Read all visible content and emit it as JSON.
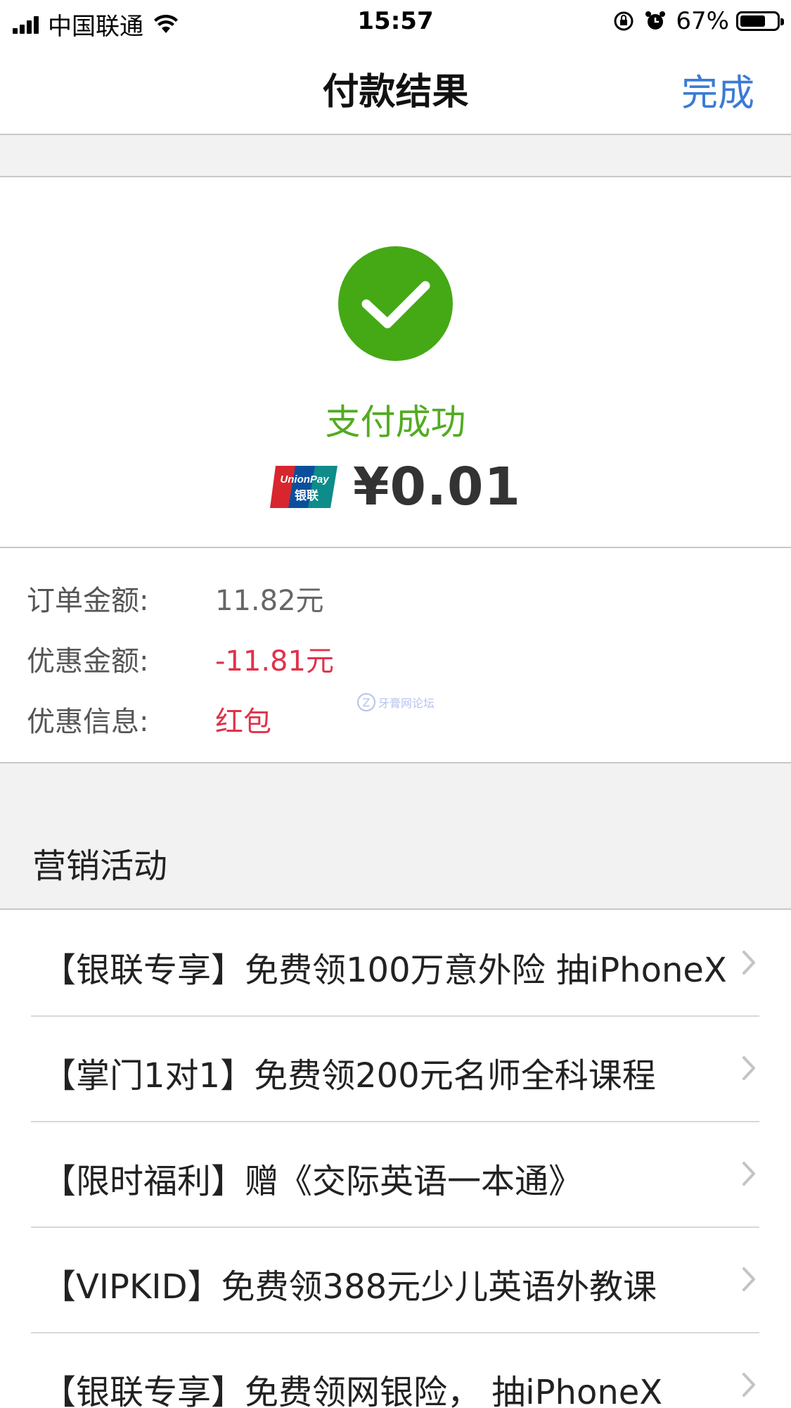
{
  "status_bar": {
    "carrier": "中国联通",
    "time": "15:57",
    "battery": "67%",
    "icons": [
      "signal-icon",
      "wifi-icon",
      "rotation-lock-icon",
      "alarm-icon",
      "battery-icon"
    ]
  },
  "nav": {
    "title": "付款结果",
    "done": "完成"
  },
  "result": {
    "status": "支付成功",
    "amount": "¥0.01",
    "payment_brand": "UnionPay 银联",
    "brand_logo_text": "UnionPay",
    "brand_logo_cn": "银联",
    "accent_color": "#44a915"
  },
  "details": {
    "rows": [
      {
        "label": "订单金额:",
        "value": "11.82元",
        "color": "#666666"
      },
      {
        "label": "优惠金额:",
        "value": "-11.81元",
        "color": "#e0324a"
      },
      {
        "label": "优惠信息:",
        "value": "红包",
        "color": "#e0324a"
      }
    ],
    "watermark": "牙膏网论坛"
  },
  "marketing": {
    "title": "营销活动",
    "items": [
      {
        "label": "【银联专享】免费领100万意外险 抽iPhoneX"
      },
      {
        "label": "【掌门1对1】免费领200元名师全科课程"
      },
      {
        "label": "【限时福利】赠《交际英语一本通》"
      },
      {
        "label": "【VIPKID】免费领388元少儿英语外教课"
      },
      {
        "label": "【银联专享】免费领网银险， 抽iPhoneX"
      }
    ]
  }
}
